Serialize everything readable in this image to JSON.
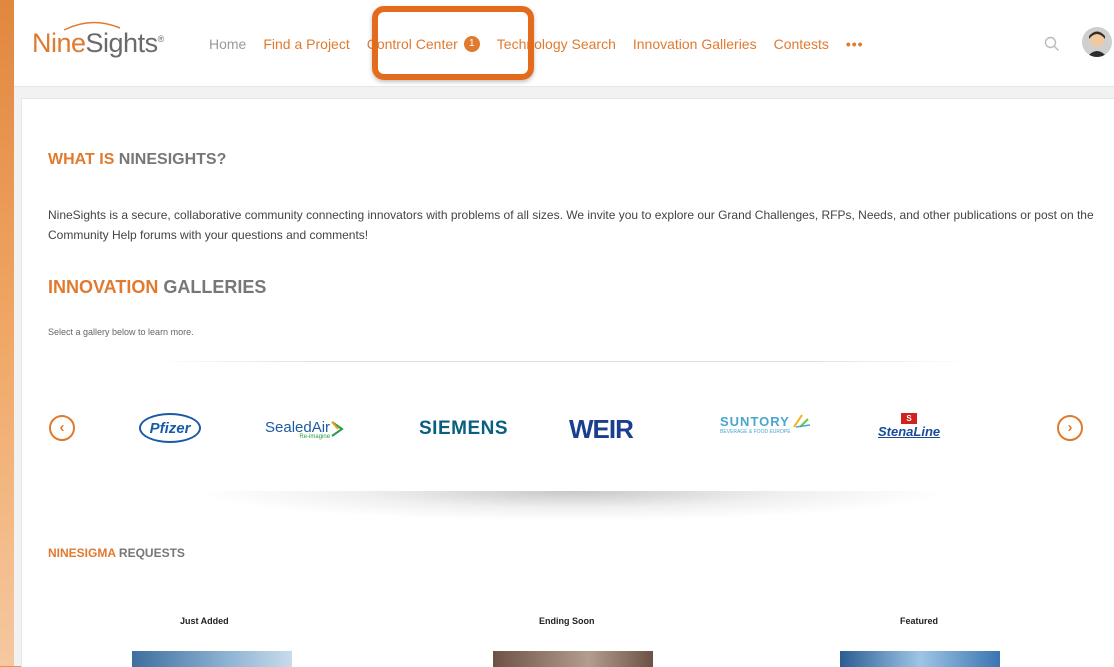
{
  "logo": {
    "nine": "Nine",
    "sights": "Sights",
    "mark": "®"
  },
  "nav": {
    "home": "Home",
    "find_project": "Find a Project",
    "control_center": "Control Center",
    "control_center_badge": "1",
    "technology_search": "Technology Search",
    "innovation_galleries": "Innovation Galleries",
    "contests": "Contests",
    "more": "•••"
  },
  "colors": {
    "accent": "#e07a2f",
    "highlight_frame": "#e46a1c",
    "heading_gray": "#777777"
  },
  "icons": {
    "search": "search-icon",
    "avatar": "avatar",
    "prev": "chevron-left-icon",
    "next": "chevron-right-icon"
  },
  "what_is": {
    "accent": "WHAT IS",
    "rest": " NINESIGHTS?"
  },
  "intro_paragraph": "NineSights is a secure, collaborative community connecting innovators with problems of all sizes.  We invite you to explore our Grand Challenges, RFPs, Needs, and other publications or post on the Community Help forums with your questions and comments!",
  "galleries": {
    "accent": "INNOVATION",
    "rest": " GALLERIES",
    "hint": "Select a gallery below to learn more.",
    "prev": "‹",
    "next": "›",
    "brands": {
      "pfizer": "Pfizer",
      "sealedair": "SealedAir",
      "sealedair_sub": "Re-imagine",
      "siemens": "SIEMENS",
      "weir": "WEIR",
      "suntory": "SUNTORY",
      "suntory_sub": "BEVERAGE & FOOD EUROPE",
      "stena_mark": "S",
      "stena": "StenaLine"
    }
  },
  "requests": {
    "accent": "NINESIGMA",
    "rest": " REQUESTS",
    "columns": [
      "Just Added",
      "Ending Soon",
      "Featured"
    ]
  }
}
